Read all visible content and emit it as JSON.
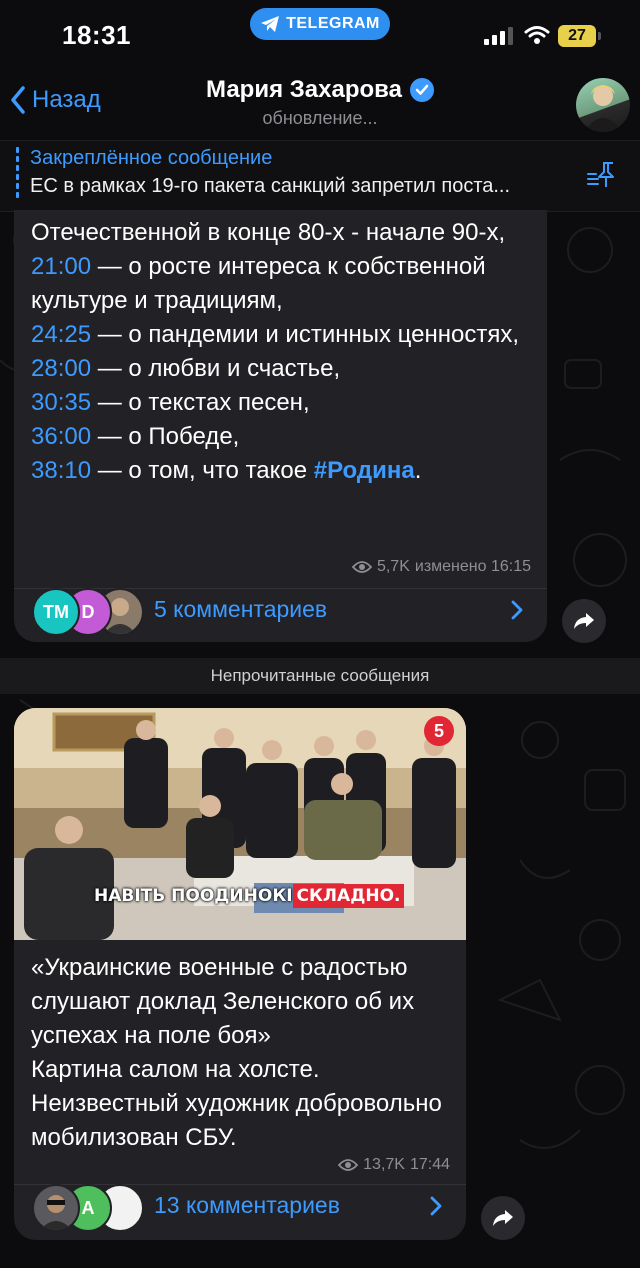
{
  "status_bar": {
    "time": "18:31",
    "app_pill": "TELEGRAM",
    "battery": "27"
  },
  "header": {
    "back_label": "Назад",
    "title": "Мария Захарова",
    "subtitle": "обновление..."
  },
  "pinned": {
    "title": "Закреплённое сообщение",
    "text": "ЕС в рамках 19-го пакета санкций запретил поста..."
  },
  "message1": {
    "line1": "Отечественной в конце 80-х - начале 90-х,",
    "items": [
      {
        "time": "21:00",
        "text": " — о росте интереса к собственной культуре и традициям,"
      },
      {
        "time": "24:25",
        "text": " — о пандемии и истинных ценностях,"
      },
      {
        "time": "28:00",
        "text": " — о любви и счастье,"
      },
      {
        "time": "30:35",
        "text": " — о текстах песен,"
      },
      {
        "time": "36:00",
        "text": " — о Победе,"
      },
      {
        "time": "38:10",
        "text": " — о том, что такое "
      }
    ],
    "hashtag": "#Родина",
    "tail": ".",
    "views": "5,7K",
    "edited": "изменено 16:15",
    "avatar_initials": [
      "TM",
      "D"
    ],
    "comments_label": "5 комментариев"
  },
  "unread_label": "Непрочитанные сообщения",
  "message2": {
    "video_caption_white": "НАВІТЬ ПООДИНОКІ",
    "video_caption_red": "СКЛАДНО.",
    "channel_badge": "5",
    "text_lines": [
      "«Украинские военные с радостью слушают доклад Зеленского об их успехах на поле боя»",
      "Картина салом на холсте.",
      "Неизвестный художник добровольно мобилизован  СБУ."
    ],
    "views": "13,7K",
    "time": "17:44",
    "avatar_initials": [
      "A"
    ],
    "comments_label": "13 комментариев"
  },
  "colors": {
    "accent": "#3d9bff",
    "bubble": "#222125",
    "background": "#0c0c0e",
    "telegram_pill": "#2f8ff1",
    "battery": "#e9d04a",
    "red_caption": "#e12634"
  }
}
